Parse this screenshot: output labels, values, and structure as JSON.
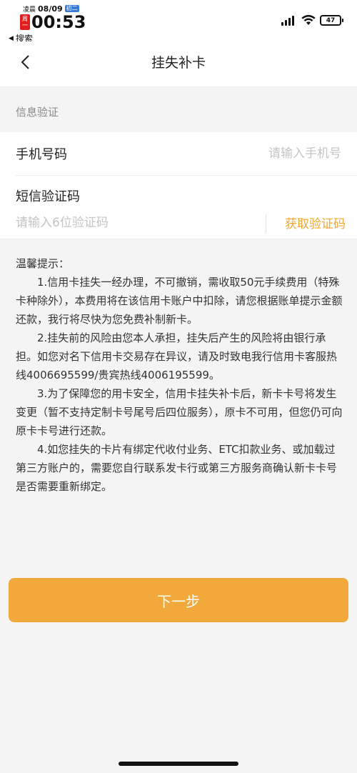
{
  "status_bar": {
    "lunar_tag": "凌晨",
    "date": "08/09",
    "lunar_day": "初二",
    "weekday_top": "周",
    "weekday_bottom": "一",
    "time": "00:53",
    "back_app": "搜索",
    "battery": "47"
  },
  "nav": {
    "title": "挂失补卡"
  },
  "section": {
    "header": "信息验证"
  },
  "form": {
    "phone_label": "手机号码",
    "phone_placeholder": "请输入手机号",
    "phone_value": "",
    "sms_label": "短信验证码",
    "sms_placeholder": "请输入6位验证码",
    "sms_value": "",
    "get_code_label": "获取验证码"
  },
  "notice": {
    "title": "温馨提示：",
    "items": [
      "1.信用卡挂失一经办理，不可撤销，需收取50元手续费用（特殊卡种除外），本费用将在该信用卡账户中扣除，请您根据账单提示金额还款，我行将尽快为您免费补制新卡。",
      "2.挂失前的风险由您本人承担，挂失后产生的风险将由银行承担。如您对名下信用卡交易存在异议，请及时致电我行信用卡客服热线4006695599/贵宾热线4006195599。",
      "3.为了保障您的用卡安全，信用卡挂失补卡后，新卡卡号将发生变更（暂不支持定制卡号尾号后四位服务），原卡不可用，但您仍可向原卡卡号进行还款。",
      "4.如您挂失的卡片有绑定代收付业务、ETC扣款业务、或加载过第三方账户的，需要您自行联系发卡行或第三方服务商确认新卡卡号是否需要重新绑定。"
    ]
  },
  "footer": {
    "next_label": "下一步"
  },
  "colors": {
    "accent": "#f0a93a",
    "link": "#f0a733",
    "background": "#f4f4f4"
  }
}
